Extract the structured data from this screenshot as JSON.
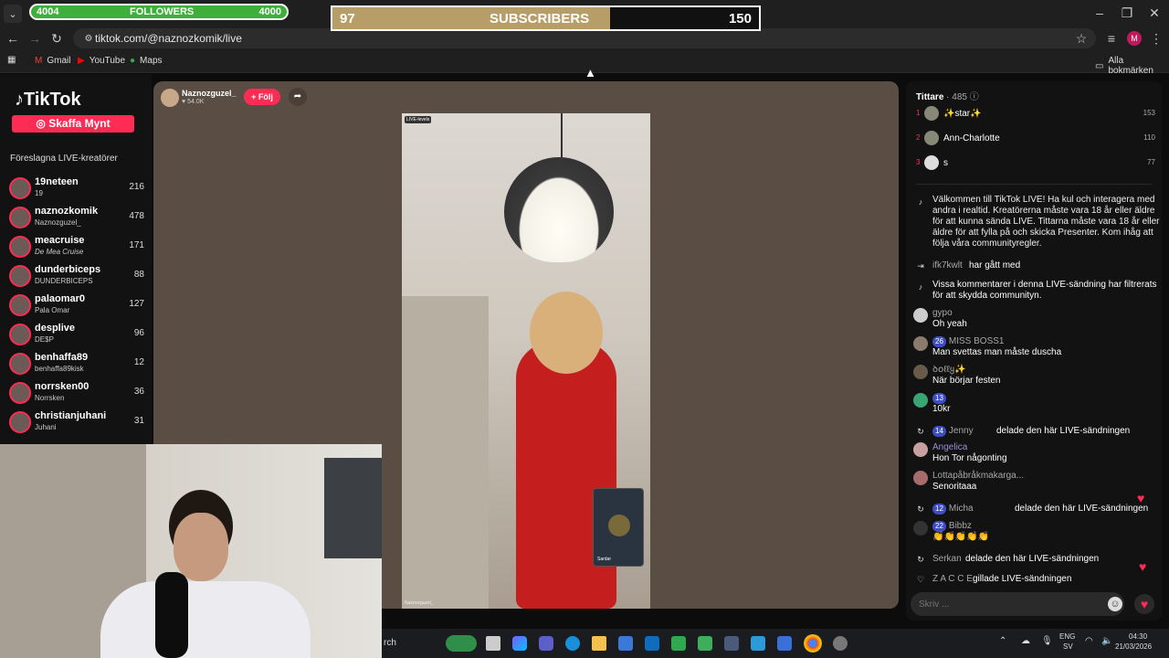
{
  "overlay": {
    "followers": {
      "left_value": "4004",
      "label": "FOLLOWERS",
      "right_value": "4000"
    },
    "subscribers": {
      "left_value": "97",
      "label": "SUBSCRIBERS",
      "right_value": "150",
      "progress": 0.65
    }
  },
  "browser": {
    "url": "tiktok.com/@naznozkomik/live",
    "bookmarks": [
      "Gmail",
      "YouTube",
      "Maps"
    ],
    "all_bookmarks": "Alla bokmärken",
    "profile_initial": "M"
  },
  "tiktok": {
    "logo": "TikTok",
    "coins_button": "Skaffa Mynt",
    "suggested_heading": "Föreslagna LIVE-kreatörer",
    "suggested": [
      {
        "name": "19neteen",
        "sub": "19",
        "count": "216"
      },
      {
        "name": "naznozkomik",
        "sub": "Naznozguzel_",
        "count": "478"
      },
      {
        "name": "meacruise",
        "sub": "De Mea Cruise",
        "count": "171"
      },
      {
        "name": "dunderbiceps",
        "sub": "DUNDERBICEPS",
        "count": "88"
      },
      {
        "name": "palaomar0",
        "sub": "Pala Omar",
        "count": "127"
      },
      {
        "name": "desplive",
        "sub": "DE$P",
        "count": "96"
      },
      {
        "name": "benhaffa89",
        "sub": "benhaffa89kisk",
        "count": "12"
      },
      {
        "name": "norrsken00",
        "sub": "Norrsken",
        "count": "36"
      },
      {
        "name": "christianjuhani",
        "sub": "Juhani",
        "count": "31"
      }
    ],
    "host": {
      "name": "Naznozguzel_",
      "likes": "54.0K",
      "follow_button": "+ Följ"
    },
    "video_tag": "LIVE-levels",
    "video_footer": "Naznozguzel_",
    "pip_label": "Sardar"
  },
  "chat": {
    "viewers_label": "Tittare",
    "viewers_count": "485",
    "top_viewers": [
      {
        "rank": "1",
        "name": "✨star✨",
        "score": "153"
      },
      {
        "rank": "2",
        "name": "Ann-Charlotte",
        "score": "110"
      },
      {
        "rank": "3",
        "name": "s",
        "score": "77"
      }
    ],
    "welcome": [
      "Välkommen till TikTok LIVE! Ha kul och interagera med",
      "andra i realtid. Kreatörerna måste vara 18 år eller äldre",
      "för att kunna sända LIVE. Tittarna måste vara 18 år eller",
      "äldre för att fylla på och skicka Presenter. Kom ihåg att",
      "följa våra communityregler."
    ],
    "messages": [
      {
        "user": "ifk7kwlt",
        "text": "har gått med"
      },
      {
        "user": "",
        "text": "Vissa kommentarer i denna LIVE-sändning har filtrerats",
        "text2": "för att skydda communityn."
      },
      {
        "user": "gypo",
        "text": "Oh yeah"
      },
      {
        "user": "MISS BOSS1",
        "badge": "26",
        "text": "Man svettas man måste duscha"
      },
      {
        "user": "ꝺ໐ℓℓყ✨",
        "text": "När börjar festen"
      },
      {
        "user": "",
        "badge": "13",
        "text": "10kr"
      },
      {
        "user": "Jenny",
        "badge": "14",
        "text": "delade den här LIVE-sändningen"
      },
      {
        "user": "Angelica",
        "text": "Hon Tor någonting"
      },
      {
        "user": "Lottapåbråkmakarga...",
        "text": "Senoritaaa"
      },
      {
        "user": "Micha",
        "badge": "12",
        "text": "delade den här LIVE-sändningen"
      },
      {
        "user": "Bibbz",
        "badge": "22",
        "text": "👏👏👏👏👏"
      },
      {
        "user": "Serkan",
        "text": "delade den här LIVE-sändningen"
      },
      {
        "user": "Z A C C E",
        "text": "gillade LIVE-sändningen"
      }
    ],
    "input_placeholder": "Skriv ..."
  },
  "taskbar": {
    "search_text": "rch",
    "lang": "ENG",
    "lang_sub": "SV",
    "time": "04:30",
    "date": "21/03/2026"
  },
  "colors": {
    "accent": "#fe2c55",
    "followers_bar": "#3daf3a",
    "subscribers_fill": "#b79d67"
  }
}
